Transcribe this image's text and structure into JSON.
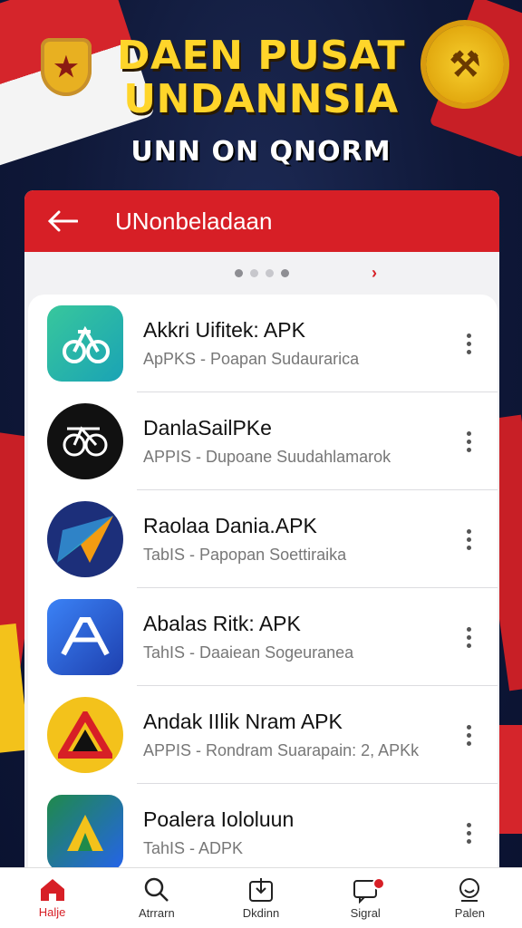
{
  "header": {
    "title_line1": "DAEN PUSAT",
    "title_line2": "UNDANNSIA",
    "subtitle": "UNN ON QNORM"
  },
  "appbar": {
    "title": "UNonbeladaan",
    "back_icon": "arrow-left-icon"
  },
  "carousel": {
    "dots": 4,
    "active_index": 0,
    "next_icon": "chevron-right-icon"
  },
  "apps": [
    {
      "name": "Akkri Uifitek: APK",
      "desc": "ApPKS - Poapan Sudaurarica",
      "icon": "bike-icon",
      "bg": "#2fbf8f"
    },
    {
      "name": "DanlaSailPKe",
      "desc": "APPIS - Dupoane Suudahlamarok",
      "icon": "bicycle-icon",
      "bg": "#111111"
    },
    {
      "name": "Raolaa Dania.APK",
      "desc": "TabIS - Papopan Soettiraika",
      "icon": "paper-plane-icon",
      "bg": "#1c2f7a"
    },
    {
      "name": "Abalas Ritk: APK",
      "desc": "TahIS - Daaiean Sogeuranea",
      "icon": "a-letter-icon",
      "bg": "#2f6bd8"
    },
    {
      "name": "Andak IIlik Nram APK",
      "desc": "APPIS - Rondram Suarapain: 2, APKk",
      "icon": "triangle-logo-icon",
      "bg": "#f3c21b"
    },
    {
      "name": "Poalera Iololuun",
      "desc": "TahIS - ADPK",
      "icon": "arrow-logo-icon",
      "bg": "#1f8a4a"
    }
  ],
  "nav": [
    {
      "label": "Halje",
      "icon": "home-icon",
      "active": true
    },
    {
      "label": "Atrrarn",
      "icon": "search-icon",
      "active": false
    },
    {
      "label": "Dkdinn",
      "icon": "download-icon",
      "active": false
    },
    {
      "label": "Sigral",
      "icon": "notification-icon",
      "active": false,
      "badge": true
    },
    {
      "label": "Palen",
      "icon": "profile-icon",
      "active": false
    }
  ],
  "colors": {
    "accent": "#d71f26",
    "banner_title": "#ffd52a",
    "background": "#0f1838"
  }
}
